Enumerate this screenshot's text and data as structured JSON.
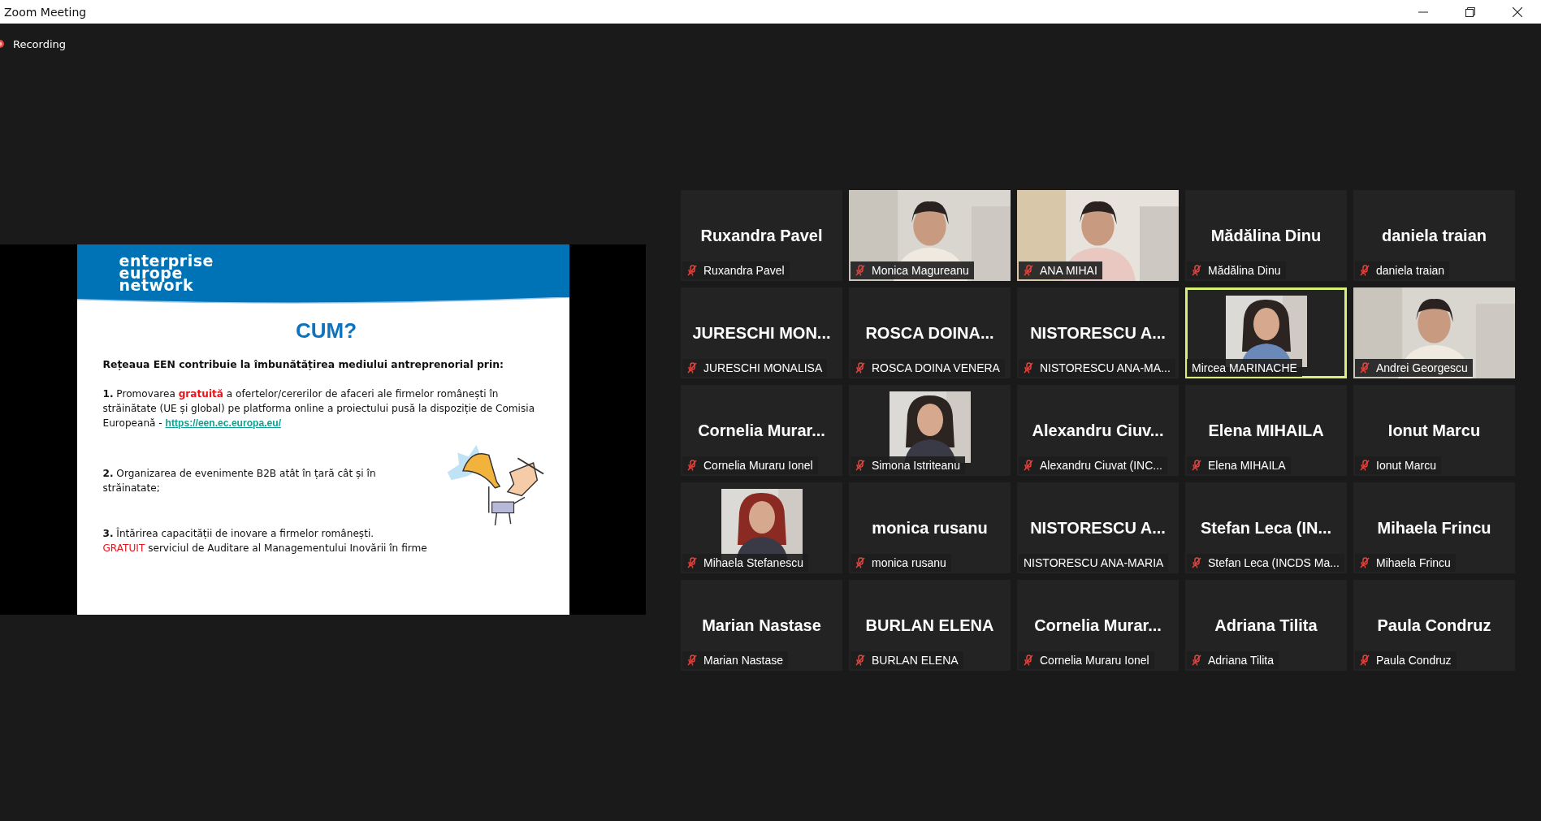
{
  "window": {
    "title": "Zoom Meeting"
  },
  "recording": {
    "label": "Recording"
  },
  "slide": {
    "logo": [
      "enterprise",
      "europe",
      "network"
    ],
    "title": "CUM?",
    "intro": "Rețeaua EEN contribuie la îmbunătățirea mediului antreprenorial prin:",
    "paragraphs": [
      {
        "parts": [
          {
            "kind": "bold",
            "text": "1."
          },
          {
            "kind": "plain",
            "text": " Promovarea "
          },
          {
            "kind": "red_bold",
            "text": "gratuită"
          },
          {
            "kind": "plain",
            "text": " a ofertelor/cererilor de afaceri ale firmelor românești în străinătate (UE și global) pe platforma online a proiectului pusă la dispoziție de Comisia Europeană - "
          },
          {
            "kind": "link",
            "text": "https://een.ec.europa.eu/"
          }
        ]
      },
      {
        "parts": [
          {
            "kind": "bold",
            "text": "2."
          },
          {
            "kind": "plain",
            "text": " Organizarea de evenimente B2B atât în țară cât și în străinatate;"
          }
        ]
      },
      {
        "parts": [
          {
            "kind": "bold",
            "text": "3."
          },
          {
            "kind": "plain",
            "text": "  Întărirea capacității de inovare a firmelor românești."
          },
          {
            "kind": "red",
            "text": "GRATUIT",
            "break_before": true
          },
          {
            "kind": "plain",
            "text": " serviciul de Auditare al Managementului Inovării în firme"
          }
        ]
      }
    ]
  },
  "participants": [
    {
      "kind": "name",
      "display": "Ruxandra Pavel",
      "label": "Ruxandra Pavel",
      "muted": true,
      "highlighted": false
    },
    {
      "kind": "video",
      "label": "Monica Magureanu",
      "muted": true,
      "highlighted": false
    },
    {
      "kind": "video",
      "label": "ANA MIHAI",
      "muted": true,
      "highlighted": false
    },
    {
      "kind": "name",
      "display": "Mădălina Dinu",
      "label": "Mădălina Dinu",
      "muted": true,
      "highlighted": false
    },
    {
      "kind": "name",
      "display": "daniela traian",
      "label": "daniela traian",
      "muted": true,
      "highlighted": false
    },
    {
      "kind": "name",
      "display": "JURESCHI  MON...",
      "label": "JURESCHI MONALISA",
      "muted": true,
      "highlighted": false
    },
    {
      "kind": "name",
      "display": "ROSCA  DOINA...",
      "label": "ROSCA DOINA VENERA",
      "muted": true,
      "highlighted": false
    },
    {
      "kind": "name",
      "display": "NISTORESCU  A...",
      "label": "NISTORESCU ANA-MA...",
      "muted": true,
      "highlighted": false
    },
    {
      "label": "Mircea MARINACHE",
      "muted": false,
      "highlighted": true
    },
    {
      "kind": "video",
      "label": "Andrei Georgescu",
      "muted": true,
      "highlighted": false
    },
    {
      "kind": "name",
      "display": "Cornelia  Murar...",
      "label": "Cornelia Muraru Ionel",
      "muted": true,
      "highlighted": false
    },
    {
      "label": "Simona Istriteanu",
      "muted": true,
      "highlighted": false
    },
    {
      "kind": "name",
      "display": "Alexandru  Ciuv...",
      "label": "Alexandru Ciuvat (INC...",
      "muted": true,
      "highlighted": false
    },
    {
      "kind": "name",
      "display": "Elena MIHAILA",
      "label": "Elena MIHAILA",
      "muted": true,
      "highlighted": false
    },
    {
      "kind": "name",
      "display": "Ionut Marcu",
      "label": "Ionut Marcu",
      "muted": true,
      "highlighted": false
    },
    {
      "label": "Mihaela Stefanescu",
      "muted": true,
      "highlighted": false
    },
    {
      "kind": "name",
      "display": "monica rusanu",
      "label": "monica rusanu",
      "muted": true,
      "highlighted": false
    },
    {
      "kind": "name",
      "display": "NISTORESCU  A...",
      "label": "NISTORESCU ANA-MARIA",
      "muted": false,
      "highlighted": false
    },
    {
      "kind": "name",
      "display": "Stefan  Leca  (IN...",
      "label": "Stefan Leca (INCDS Ma...",
      "muted": true,
      "highlighted": false
    },
    {
      "kind": "name",
      "display": "Mihaela Frincu",
      "label": "Mihaela Frincu",
      "muted": true,
      "highlighted": false
    },
    {
      "kind": "name",
      "display": "Marian Nastase",
      "label": "Marian Nastase",
      "muted": true,
      "highlighted": false
    },
    {
      "kind": "name",
      "display": "BURLAN ELENA",
      "label": "BURLAN ELENA",
      "muted": true,
      "highlighted": false
    },
    {
      "kind": "name",
      "display": "Cornelia  Murar...",
      "label": "Cornelia Muraru Ionel",
      "muted": true,
      "highlighted": false
    },
    {
      "kind": "name",
      "display": "Adriana Tilita",
      "label": "Adriana Tilita",
      "muted": true,
      "highlighted": false
    },
    {
      "kind": "name",
      "display": "Paula Condruz",
      "label": "Paula Condruz",
      "muted": true,
      "highlighted": false
    }
  ]
}
